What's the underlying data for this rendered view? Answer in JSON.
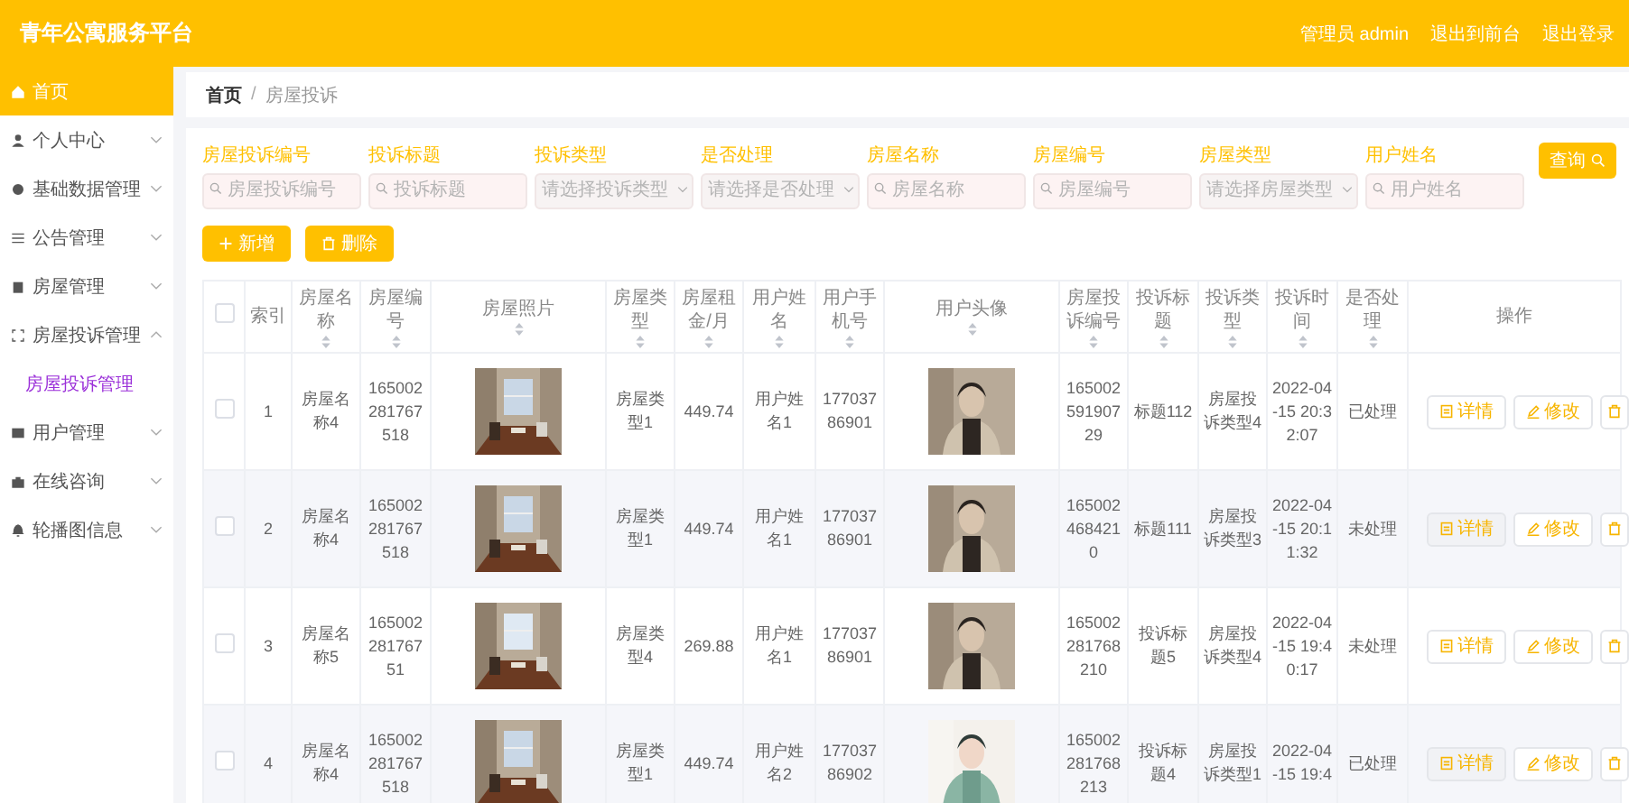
{
  "header": {
    "title": "青年公寓服务平台",
    "links": [
      "管理员 admin",
      "退出到前台",
      "退出登录"
    ]
  },
  "sidebar": {
    "items": [
      {
        "label": "首页",
        "selected": true
      },
      {
        "label": "个人中心",
        "selected": false,
        "expanded": false
      },
      {
        "label": "基础数据管理",
        "selected": false,
        "expanded": false
      },
      {
        "label": "公告管理",
        "selected": false,
        "expanded": false
      },
      {
        "label": "房屋管理",
        "selected": false,
        "expanded": false
      },
      {
        "label": "房屋投诉管理",
        "selected": false,
        "expanded": true,
        "children": [
          {
            "label": "房屋投诉管理",
            "selected": true
          }
        ]
      },
      {
        "label": "用户管理",
        "selected": false,
        "expanded": false
      },
      {
        "label": "在线咨询",
        "selected": false,
        "expanded": false
      },
      {
        "label": "轮播图信息",
        "selected": false,
        "expanded": false
      }
    ]
  },
  "breadcrumb": {
    "items": [
      "首页",
      "房屋投诉"
    ],
    "separator": "/"
  },
  "search": {
    "fields": [
      {
        "label": "房屋投诉编号",
        "placeholder": "房屋投诉编号",
        "kind": "input"
      },
      {
        "label": "投诉标题",
        "placeholder": "投诉标题",
        "kind": "input"
      },
      {
        "label": "投诉类型",
        "placeholder": "请选择投诉类型",
        "kind": "select"
      },
      {
        "label": "是否处理",
        "placeholder": "请选择是否处理",
        "kind": "select"
      },
      {
        "label": "房屋名称",
        "placeholder": "房屋名称",
        "kind": "input"
      },
      {
        "label": "房屋编号",
        "placeholder": "房屋编号",
        "kind": "input"
      },
      {
        "label": "房屋类型",
        "placeholder": "请选择房屋类型",
        "kind": "select"
      },
      {
        "label": "用户姓名",
        "placeholder": "用户姓名",
        "kind": "input"
      }
    ],
    "button": "查询"
  },
  "actions": [
    {
      "label": "新增",
      "kind": "add"
    },
    {
      "label": "删除",
      "kind": "delete"
    }
  ],
  "table": {
    "header_checked": false,
    "columns": [
      {
        "label": "索引",
        "sortable": false,
        "kind": "text"
      },
      {
        "label": "房屋名称",
        "sortable": true,
        "kind": "text"
      },
      {
        "label": "房屋编号",
        "sortable": true,
        "kind": "text"
      },
      {
        "label": "房屋照片",
        "sortable": true,
        "kind": "room"
      },
      {
        "label": "房屋类型",
        "sortable": true,
        "kind": "text"
      },
      {
        "label": "房屋租金/月",
        "sortable": true,
        "kind": "text"
      },
      {
        "label": "用户姓名",
        "sortable": true,
        "kind": "text"
      },
      {
        "label": "用户手机号",
        "sortable": true,
        "kind": "text"
      },
      {
        "label": "用户头像",
        "sortable": true,
        "kind": "person"
      },
      {
        "label": "房屋投诉编号",
        "sortable": true,
        "kind": "text"
      },
      {
        "label": "投诉标题",
        "sortable": true,
        "kind": "text"
      },
      {
        "label": "投诉类型",
        "sortable": true,
        "kind": "text"
      },
      {
        "label": "投诉时间",
        "sortable": true,
        "kind": "text"
      },
      {
        "label": "是否处理",
        "sortable": true,
        "kind": "text"
      },
      {
        "label": "操作",
        "sortable": false,
        "kind": "actions"
      }
    ],
    "rows": [
      {
        "checked": false,
        "cells": [
          "1",
          "房屋名称4",
          "165002281767518",
          {
            "kind": "picture"
          },
          "房屋类型1",
          "449.74",
          "用户姓名1",
          "17703786901",
          {
            "kind": "picture"
          },
          "16500259190729",
          "标题112",
          "房屋投诉类型4",
          "2022-04-15 20:32:07",
          "已处理",
          {
            "actions": [
              {
                "label": "详情",
                "kind": "detail"
              },
              {
                "label": "修改",
                "kind": "edit"
              },
              {
                "kind": "delete"
              }
            ]
          }
        ]
      },
      {
        "checked": false,
        "cells": [
          "2",
          "房屋名称4",
          "165002281767518",
          {
            "kind": "picture"
          },
          "房屋类型1",
          "449.74",
          "用户姓名1",
          "17703786901",
          {
            "kind": "picture"
          },
          "1650024684210",
          "标题111",
          "房屋投诉类型3",
          "2022-04-15 20:11:32",
          "未处理",
          {
            "actions": [
              {
                "label": "详情",
                "kind": "detail"
              },
              {
                "label": "修改",
                "kind": "edit"
              },
              {
                "kind": "delete"
              }
            ]
          }
        ]
      },
      {
        "checked": false,
        "cells": [
          "3",
          "房屋名称5",
          "16500228176751",
          {
            "kind": "picture"
          },
          "房屋类型4",
          "269.88",
          "用户姓名1",
          "17703786901",
          {
            "kind": "picture"
          },
          "165002281768210",
          "投诉标题5",
          "房屋投诉类型4",
          "2022-04-15 19:40:17",
          "未处理",
          {
            "actions": [
              {
                "label": "详情",
                "kind": "detail"
              },
              {
                "label": "修改",
                "kind": "edit"
              },
              {
                "kind": "delete"
              }
            ]
          }
        ]
      },
      {
        "checked": false,
        "cells": [
          "4",
          "房屋名称4",
          "165002281767518",
          {
            "kind": "picture"
          },
          "房屋类型1",
          "449.74",
          "用户姓名2",
          "17703786902",
          {
            "kind": "picture"
          },
          "165002281768213",
          "投诉标题4",
          "房屋投诉类型1",
          "2022-04-15 19:4",
          "已处理",
          {
            "actions": [
              {
                "label": "详情",
                "kind": "detail"
              },
              {
                "label": "修改",
                "kind": "edit"
              },
              {
                "kind": "delete"
              }
            ]
          }
        ]
      }
    ]
  }
}
